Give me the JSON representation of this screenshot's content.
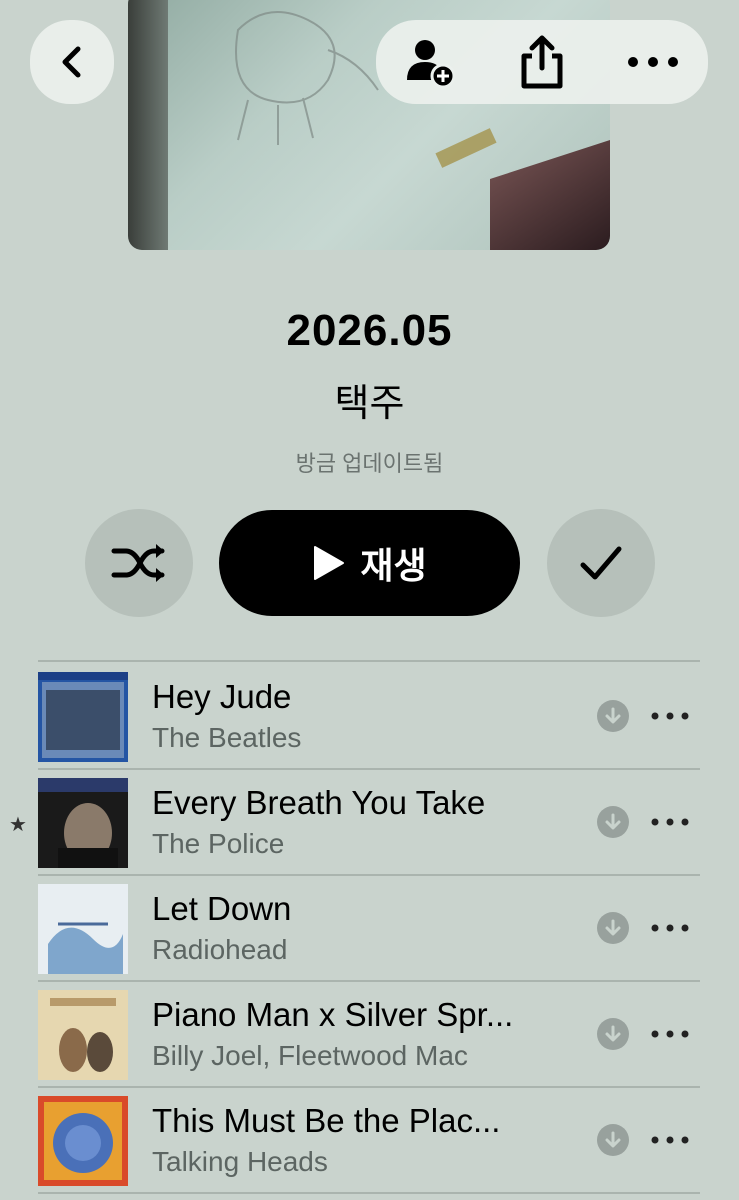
{
  "header": {
    "back_icon": "chevron-left-icon",
    "actions": [
      "add-person-icon",
      "share-icon",
      "more-icon"
    ]
  },
  "playlist": {
    "title": "2026.05",
    "owner": "택주",
    "updated": "방금 업데이트됨"
  },
  "controls": {
    "shuffle_icon": "shuffle-icon",
    "play_label": "재생",
    "check_icon": "checkmark-icon"
  },
  "songs": [
    {
      "title": "Hey Jude",
      "artist": "The Beatles",
      "starred": false
    },
    {
      "title": "Every Breath You Take",
      "artist": "The Police",
      "starred": true,
      "star": "★"
    },
    {
      "title": "Let Down",
      "artist": "Radiohead",
      "starred": false
    },
    {
      "title": "Piano Man x Silver Spr...",
      "artist": "Billy Joel, Fleetwood Mac",
      "starred": false
    },
    {
      "title": "This Must Be the Plac...",
      "artist": "Talking Heads",
      "starred": false
    }
  ],
  "colors": {
    "background": "#c9d3cd",
    "play_button": "#000000",
    "secondary_text": "#5c6562"
  }
}
